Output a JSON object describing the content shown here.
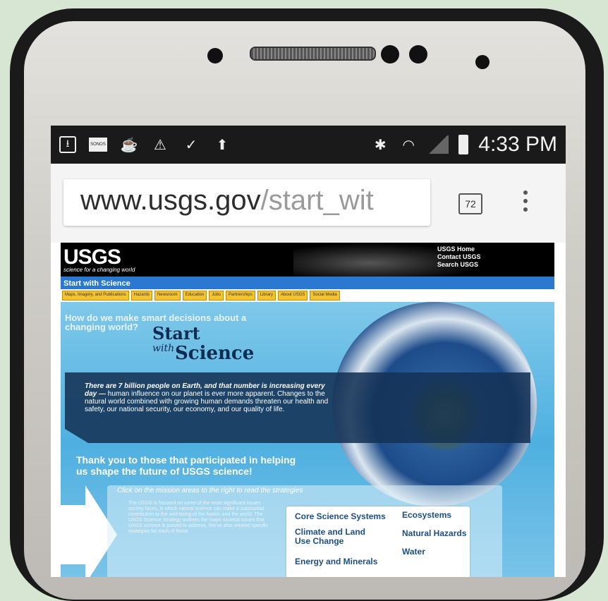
{
  "status_bar": {
    "time": "4:33 PM",
    "notification_icons": [
      "download-icon",
      "sonos-icon",
      "coffee-cup-icon",
      "warning-icon",
      "clipboard-check-icon",
      "briefcase-upload-icon"
    ],
    "sonos_label": "SONOS",
    "system_icons": [
      "bluetooth-icon",
      "wifi-icon",
      "signal-icon",
      "battery-icon"
    ]
  },
  "browser": {
    "url_host": "www.usgs.gov",
    "url_path": "/start_wit",
    "tab_count": "72"
  },
  "page": {
    "logo": "USGS",
    "logo_tagline": "science for a changing world",
    "top_links": [
      "USGS Home",
      "Contact USGS",
      "Search USGS"
    ],
    "section_title": "Start with Science",
    "nav": [
      "Maps, Imagery, and Publications",
      "Hazards",
      "Newsroom",
      "Education",
      "Jobs",
      "Partnerships",
      "Library",
      "About USGS",
      "Social Media"
    ],
    "hero_question": "How do we make smart decisions about a changing world?",
    "start": "Start",
    "with": "with",
    "science": "Science",
    "banner_bold": "There are 7 billion people on Earth, and that number is increasing every day —",
    "banner_text": " human influence on our planet is ever more apparent. Changes to the natural world combined with growing human demands threaten our health and safety, our national security, our economy, and our quality of life.",
    "thanks": "Thank you to those that participated in helping us shape the future of USGS science!",
    "mission_head": "Click on the mission areas to the right to read the strategies",
    "mission_body": "The USGS is focused on some of the most significant issues society faces, in which natural science can make a substantial contribution to the well-being of the Nation and the world. The USGS Science Strategy outlines the major societal issues that USGS science is poised to address. We've also created specific strategies for each of those",
    "mission_areas": [
      "Core Science Systems",
      "Ecosystems",
      "Climate and Land Use Change",
      "Natural Hazards",
      "Water",
      "Energy and Minerals"
    ]
  }
}
